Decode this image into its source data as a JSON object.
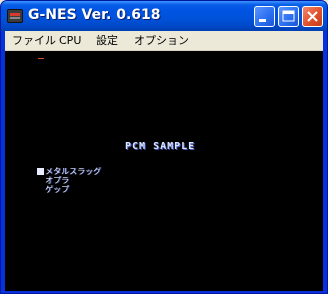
{
  "window": {
    "title": "G-NES Ver. 0.618",
    "buttons": {
      "minimize": "minimize-icon",
      "maximize": "maximize-icon",
      "close": "close-icon"
    }
  },
  "menu": {
    "items": [
      "ファイル",
      "CPU",
      "設定",
      "オプション"
    ]
  },
  "screen": {
    "title": "PCM SAMPLE",
    "songs": [
      {
        "label": "メタルスラッグ",
        "selected": true
      },
      {
        "label": "オプラ",
        "selected": false
      },
      {
        "label": "ゲップ",
        "selected": false
      }
    ]
  },
  "colors": {
    "titlebar": "#0054e3",
    "screen_bg": "#000000",
    "text": "#e0e8ff",
    "cursor": "#d64b2e"
  }
}
